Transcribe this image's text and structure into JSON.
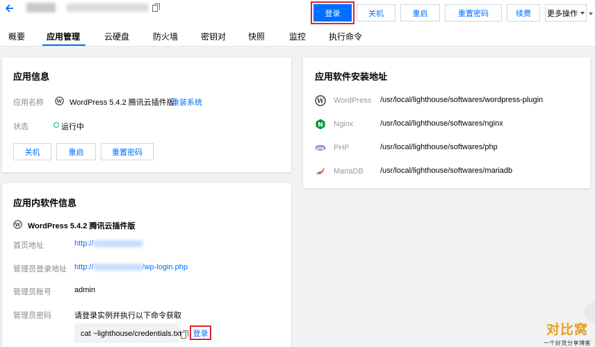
{
  "header": {
    "buttons": {
      "login": "登录",
      "shutdown": "关机",
      "restart": "重启",
      "reset_password": "重置密码",
      "renew": "续费",
      "more": "更多操作"
    }
  },
  "tabs": [
    {
      "label": "概要"
    },
    {
      "label": "应用管理"
    },
    {
      "label": "云硬盘"
    },
    {
      "label": "防火墙"
    },
    {
      "label": "密钥对"
    },
    {
      "label": "快照"
    },
    {
      "label": "监控"
    },
    {
      "label": "执行命令"
    }
  ],
  "app_info": {
    "title": "应用信息",
    "name_label": "应用名称",
    "name_value": "WordPress 5.4.2 腾讯云插件版",
    "reinstall_link": "重装系统",
    "status_label": "状态",
    "status_value": "运行中",
    "buttons": {
      "shutdown": "关机",
      "restart": "重启",
      "reset_password": "重置密码"
    }
  },
  "install_paths": {
    "title": "应用软件安装地址",
    "items": [
      {
        "name": "WordPress",
        "path": "/usr/local/lighthouse/softwares/wordpress-plugin",
        "icon": "wordpress-icon"
      },
      {
        "name": "Nginx",
        "path": "/usr/local/lighthouse/softwares/nginx",
        "icon": "nginx-icon"
      },
      {
        "name": "PHP",
        "path": "/usr/local/lighthouse/softwares/php",
        "icon": "php-icon"
      },
      {
        "name": "MariaDB",
        "path": "/usr/local/lighthouse/softwares/mariadb",
        "icon": "mariadb-icon"
      }
    ]
  },
  "software_info": {
    "title": "应用内软件信息",
    "subtitle": "WordPress 5.4.2 腾讯云插件版",
    "home_label": "首页地址",
    "home_prefix": "http://",
    "admin_login_label": "管理员登录地址",
    "admin_login_prefix": "http://",
    "admin_login_suffix": "/wp-login.php",
    "admin_account_label": "管理员账号",
    "admin_account_value": "admin",
    "admin_password_label": "管理员密码",
    "admin_password_hint": "请登录实例并执行以下命令获取",
    "command": "cat ~lighthouse/credentials.txt",
    "login_link": "登录"
  },
  "watermark": {
    "title": "对比窝",
    "subtitle": "一个好货分享博客"
  },
  "colors": {
    "primary": "#006eff",
    "highlight": "#e0212f",
    "status_ok": "#0abf5b",
    "nginx": "#009639",
    "watermark": "#e8a01a"
  }
}
